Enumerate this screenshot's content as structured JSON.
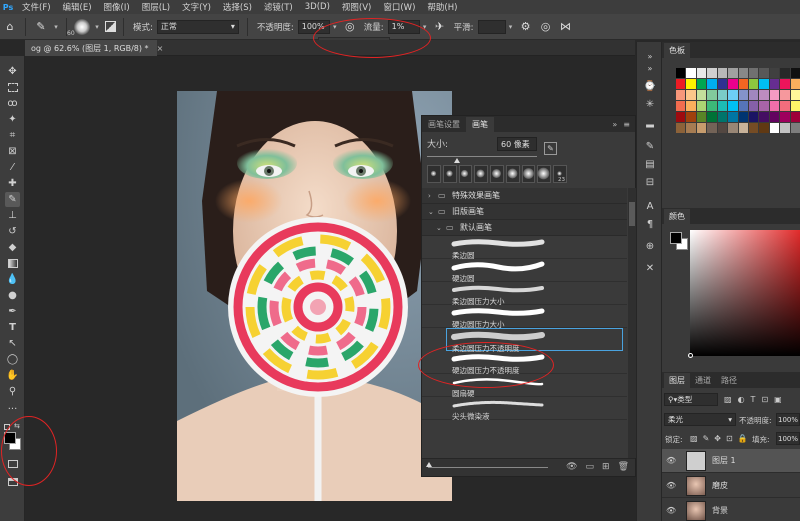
{
  "menu": [
    "文件(F)",
    "编辑(E)",
    "图像(I)",
    "图层(L)",
    "文字(Y)",
    "选择(S)",
    "滤镜(T)",
    "3D(D)",
    "视图(V)",
    "窗口(W)",
    "帮助(H)"
  ],
  "options": {
    "brush_size": "60",
    "mode_label": "模式:",
    "mode_value": "正常",
    "opacity_label": "不透明度:",
    "opacity_value": "100%",
    "flow_label": "流量:",
    "flow_value": "1%",
    "smooth_label": "平滑:"
  },
  "document_tab": {
    "title": "og @ 62.6% (图层 1, RGB/8) *",
    "close": "×"
  },
  "brush_panel": {
    "tabs": [
      "画笔设置",
      "画笔"
    ],
    "size_label": "大小:",
    "size_value": "60 像素",
    "tip_number": "23",
    "groups": [
      {
        "label": "特殊效果画笔",
        "expanded": false
      },
      {
        "label": "旧版画笔",
        "expanded": true
      }
    ],
    "subgroup": "默认画笔",
    "brushes": [
      "柔边圆",
      "硬边圆",
      "柔边圆压力大小",
      "硬边圆压力大小",
      "柔边圆压力不透明度",
      "硬边圆压力不透明度",
      "圆扇硬",
      "尖头微染液"
    ],
    "selected_index": 4
  },
  "swatches_panel": {
    "title": "色板",
    "colors": [
      [
        "#000000",
        "#ffffff",
        "#e8e8e8",
        "#d0d0d0",
        "#b8b8b8",
        "#a0a0a0",
        "#888888",
        "#707070",
        "#585858",
        "#404040",
        "#282828",
        "#101010"
      ],
      [
        "#ed1c24",
        "#fff200",
        "#00a651",
        "#00aeef",
        "#2e3192",
        "#ec008c",
        "#f26522",
        "#8dc63f",
        "#00bff3",
        "#662d91",
        "#ed145b",
        "#fbaf5d"
      ],
      [
        "#f7977a",
        "#fdc68a",
        "#c4df9b",
        "#82ca9c",
        "#7accc8",
        "#6dcff6",
        "#8493ca",
        "#a187be",
        "#bd8cbf",
        "#f49ac2",
        "#f6989d",
        "#fff799"
      ],
      [
        "#f26c4f",
        "#fbaf5d",
        "#acd373",
        "#3cb878",
        "#1cbbb4",
        "#00bff3",
        "#5674b9",
        "#8560a8",
        "#a864a8",
        "#f06eaa",
        "#f26d7d",
        "#fff568"
      ],
      [
        "#9e0b0f",
        "#a0410d",
        "#598527",
        "#007236",
        "#00746b",
        "#0076a3",
        "#003471",
        "#1b1464",
        "#440e62",
        "#630460",
        "#9e005d",
        "#9e0039"
      ],
      [
        "#8c6239",
        "#a67c52",
        "#c69c6d",
        "#736357",
        "#534741",
        "#998675",
        "#c7b299",
        "#754c24",
        "#603913",
        "#ffffff",
        "#c2c2c2",
        "#7d7d7d"
      ]
    ]
  },
  "color_panel": {
    "title": "颜色"
  },
  "layers_panel": {
    "tabs": [
      "图层",
      "通道",
      "路径"
    ],
    "filter_label": "类型",
    "blend_mode": "柔光",
    "opacity_label": "不透明度:",
    "opacity_value": "100%",
    "lock_label": "锁定:",
    "fill_label": "填充:",
    "fill_value": "100%",
    "layers": [
      {
        "name": "图层 1",
        "active": true,
        "thumb": "#cfcfcf"
      },
      {
        "name": "磨皮",
        "active": false,
        "thumb": "#b08c7a"
      },
      {
        "name": "背景",
        "active": false,
        "thumb": "#a58574"
      }
    ]
  }
}
